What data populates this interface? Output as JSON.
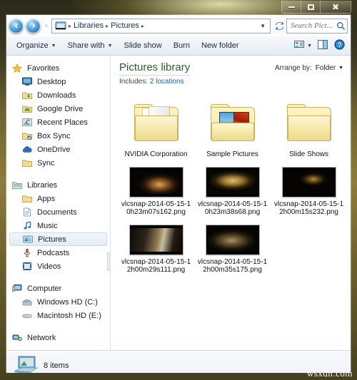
{
  "window": {
    "title": "",
    "buttons": {
      "minimize": "minimize",
      "maximize": "maximize",
      "close": "close"
    }
  },
  "navigation": {
    "back_label": "Back",
    "forward_label": "Forward",
    "recent_pages_label": "Recent pages",
    "breadcrumbs": [
      "Libraries",
      "Pictures"
    ],
    "breadcrumb_separator": "▸",
    "dropdown_caret": "▼",
    "refresh_label": "Refresh",
    "address_icon": "library-icon"
  },
  "search": {
    "placeholder": "Search Pict...",
    "value": "",
    "icon": "search-icon"
  },
  "toolbar": {
    "items": [
      {
        "label": "Organize",
        "caret": "▼"
      },
      {
        "label": "Share with",
        "caret": "▼"
      },
      {
        "label": "Slide show",
        "caret": ""
      },
      {
        "label": "Burn",
        "caret": ""
      },
      {
        "label": "New folder",
        "caret": ""
      }
    ],
    "view_icon": "change-view-icon",
    "view_caret": "▼",
    "preview_pane_icon": "preview-pane-icon",
    "help_icon": "help-icon",
    "help_glyph": "?"
  },
  "sidebar": {
    "groups": [
      {
        "header": {
          "label": "Favorites",
          "icon": "star-icon"
        },
        "items": [
          {
            "label": "Desktop",
            "icon": "desktop-icon",
            "selected": false
          },
          {
            "label": "Downloads",
            "icon": "downloads-folder-icon",
            "selected": false
          },
          {
            "label": "Google Drive",
            "icon": "google-drive-icon",
            "selected": false
          },
          {
            "label": "Recent Places",
            "icon": "recent-places-icon",
            "selected": false
          },
          {
            "label": "Box Sync",
            "icon": "box-sync-folder-icon",
            "selected": false
          },
          {
            "label": "OneDrive",
            "icon": "onedrive-icon",
            "selected": false
          },
          {
            "label": "Sync",
            "icon": "folder-icon",
            "selected": false
          }
        ]
      },
      {
        "header": {
          "label": "Libraries",
          "icon": "libraries-icon"
        },
        "items": [
          {
            "label": "Apps",
            "icon": "folder-icon",
            "selected": false
          },
          {
            "label": "Documents",
            "icon": "documents-library-icon",
            "selected": false
          },
          {
            "label": "Music",
            "icon": "music-library-icon",
            "selected": false
          },
          {
            "label": "Pictures",
            "icon": "pictures-library-icon",
            "selected": true
          },
          {
            "label": "Podcasts",
            "icon": "podcasts-icon",
            "selected": false
          },
          {
            "label": "Videos",
            "icon": "videos-library-icon",
            "selected": false
          }
        ]
      },
      {
        "header": {
          "label": "Computer",
          "icon": "computer-icon"
        },
        "items": [
          {
            "label": "Windows HD (C:)",
            "icon": "hard-drive-icon",
            "selected": false
          },
          {
            "label": "Macintosh HD (E:)",
            "icon": "disk-drive-icon",
            "selected": false
          }
        ]
      },
      {
        "header": {
          "label": "Network",
          "icon": "network-icon"
        },
        "items": []
      }
    ]
  },
  "content": {
    "library_title": "Pictures library",
    "includes_label": "Includes:",
    "includes_value": "2 locations",
    "arrange_by_label": "Arrange by:",
    "arrange_by_value": "Folder",
    "arrange_caret": "▼",
    "items": [
      {
        "name": "NVIDIA Corporation",
        "type": "folder",
        "thumb": "folder-documents"
      },
      {
        "name": "Sample Pictures",
        "type": "folder",
        "thumb": "folder-pictures"
      },
      {
        "name": "Slide Shows",
        "type": "folder",
        "thumb": "folder-empty"
      },
      {
        "name": "vlcsnap-2014-05-15-10h23m07s162.png",
        "type": "image",
        "thumb": "photo-1"
      },
      {
        "name": "vlcsnap-2014-05-15-10h23m38s68.png",
        "type": "image",
        "thumb": "photo-2"
      },
      {
        "name": "vlcsnap-2014-05-15-12h00m15s232.png",
        "type": "image",
        "thumb": "photo-3"
      },
      {
        "name": "vlcsnap-2014-05-15-12h00m29s111.png",
        "type": "image",
        "thumb": "photo-4"
      },
      {
        "name": "vlcsnap-2014-05-15-12h00m35s175.png",
        "type": "image",
        "thumb": "photo-5"
      }
    ]
  },
  "status": {
    "icon": "computer-monitor-icon",
    "text": "8 items"
  },
  "watermark": {
    "text": "wsxdn.com"
  },
  "colors": {
    "frame": "#8d7c3c",
    "library_title": "#2c5d2c",
    "link": "#1a5fa8",
    "selection": "#e3ebf3"
  }
}
